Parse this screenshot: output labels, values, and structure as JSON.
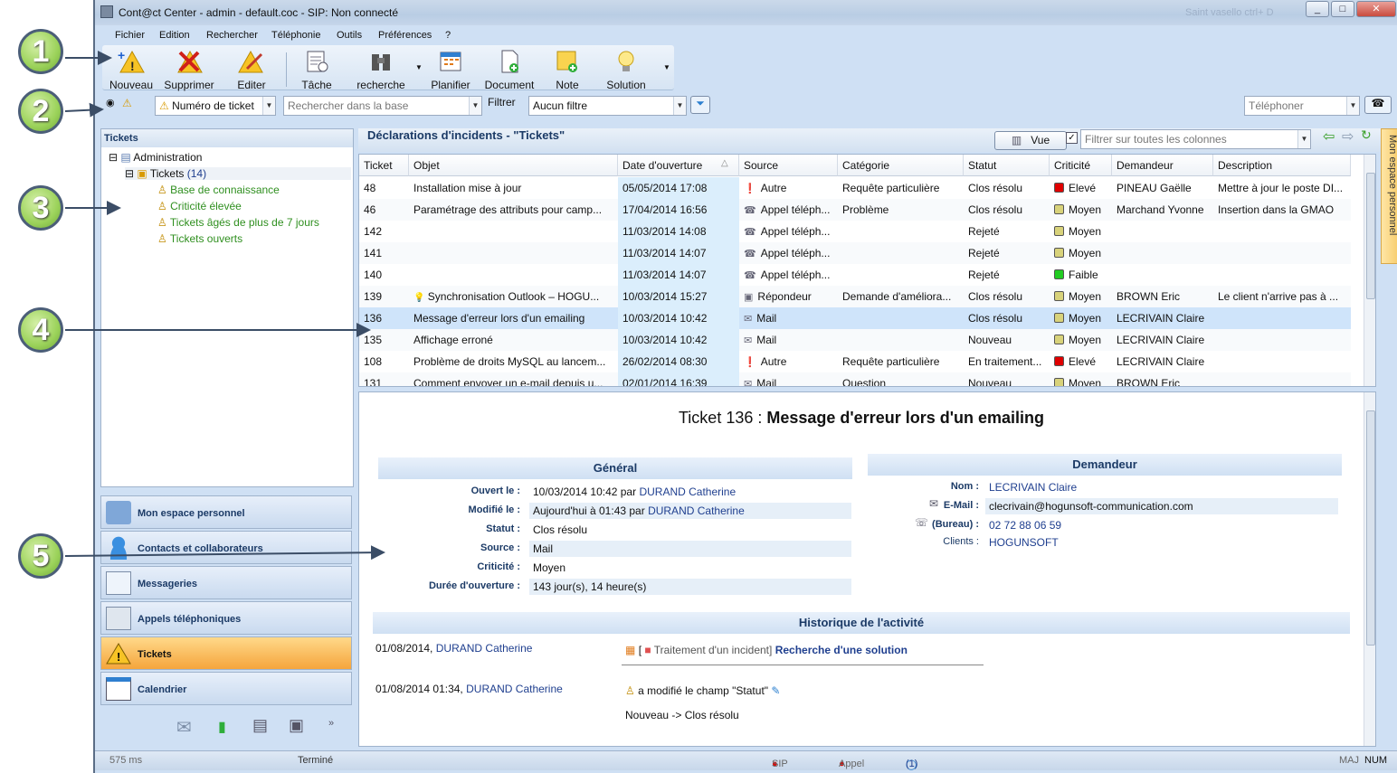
{
  "window": {
    "title": "Cont@ct Center - admin - default.coc - SIP: Non connecté",
    "blurred_title": "Saint vasello ctrl+ D"
  },
  "menu": [
    "Fichier",
    "Edition",
    "Rechercher",
    "Téléphonie",
    "Outils",
    "Préférences",
    "?"
  ],
  "toolbar": {
    "nouveau": "Nouveau",
    "supprimer": "Supprimer",
    "editer": "Editer",
    "tache": "Tâche",
    "recherche": "recherche",
    "planifier": "Planifier",
    "document": "Document",
    "note": "Note",
    "solution": "Solution"
  },
  "searchbar": {
    "field": "Numéro de ticket",
    "search_placeholder": "Rechercher dans la base",
    "filter_label": "Filtrer",
    "filter_value": "Aucun filtre",
    "phone_placeholder": "Téléphoner"
  },
  "tree": {
    "header": "Tickets",
    "root": "Administration",
    "tickets": "Tickets",
    "tickets_count": "(14)",
    "children": [
      "Base de connaissance",
      "Criticité élevée",
      "Tickets âgés de plus de 7 jours",
      "Tickets ouverts"
    ]
  },
  "nav": [
    "Mon espace personnel",
    "Contacts et collaborateurs",
    "Messageries",
    "Appels téléphoniques",
    "Tickets",
    "Calendrier"
  ],
  "grid": {
    "title": "Déclarations d'incidents - \"Tickets\"",
    "vue_button": "Vue",
    "filter_placeholder": "Filtrer sur toutes les colonnes",
    "columns": [
      "Ticket",
      "Objet",
      "Date d'ouverture",
      "Source",
      "Catégorie",
      "Statut",
      "Criticité",
      "Demandeur",
      "Description"
    ],
    "rows": [
      {
        "ticket": "48",
        "objet": "Installation mise à jour",
        "date": "05/05/2014 17:08",
        "source": "Autre",
        "categorie": "Requête particulière",
        "statut": "Clos résolu",
        "crit": "Elevé",
        "critcolor": "#e00000",
        "demandeur": "PINEAU Gaëlle",
        "desc": "Mettre à jour le poste DI..."
      },
      {
        "ticket": "46",
        "objet": "Paramétrage des attributs pour camp...",
        "date": "17/04/2014 16:56",
        "source": "Appel téléph...",
        "categorie": "Problème",
        "statut": "Clos résolu",
        "crit": "Moyen",
        "critcolor": "#d8d27a",
        "demandeur": "Marchand Yvonne",
        "desc": "Insertion dans la GMAO"
      },
      {
        "ticket": "142",
        "objet": "",
        "date": "11/03/2014 14:08",
        "source": "Appel téléph...",
        "categorie": "",
        "statut": "Rejeté",
        "crit": "Moyen",
        "critcolor": "#d8d27a",
        "demandeur": "",
        "desc": ""
      },
      {
        "ticket": "141",
        "objet": "",
        "date": "11/03/2014 14:07",
        "source": "Appel téléph...",
        "categorie": "",
        "statut": "Rejeté",
        "crit": "Moyen",
        "critcolor": "#d8d27a",
        "demandeur": "",
        "desc": ""
      },
      {
        "ticket": "140",
        "objet": "",
        "date": "11/03/2014 14:07",
        "source": "Appel téléph...",
        "categorie": "",
        "statut": "Rejeté",
        "crit": "Faible",
        "critcolor": "#22cc22",
        "demandeur": "",
        "desc": ""
      },
      {
        "ticket": "139",
        "objet": "Synchronisation Outlook – HOGU...",
        "date": "10/03/2014 15:27",
        "source": "Répondeur",
        "categorie": "Demande d'améliora...",
        "statut": "Clos résolu",
        "crit": "Moyen",
        "critcolor": "#d8d27a",
        "demandeur": "BROWN Eric",
        "desc": "Le client n'arrive pas à ..."
      },
      {
        "ticket": "136",
        "objet": "Message d'erreur lors d'un emailing",
        "date": "10/03/2014 10:42",
        "source": "Mail",
        "categorie": "",
        "statut": "Clos résolu",
        "crit": "Moyen",
        "critcolor": "#d8d27a",
        "demandeur": "LECRIVAIN Claire",
        "desc": ""
      },
      {
        "ticket": "135",
        "objet": "Affichage erroné",
        "date": "10/03/2014 10:42",
        "source": "Mail",
        "categorie": "",
        "statut": "Nouveau",
        "crit": "Moyen",
        "critcolor": "#d8d27a",
        "demandeur": "LECRIVAIN Claire",
        "desc": ""
      },
      {
        "ticket": "108",
        "objet": "Problème de droits MySQL au lancem...",
        "date": "26/02/2014 08:30",
        "source": "Autre",
        "categorie": "Requête particulière",
        "statut": "En traitement...",
        "crit": "Elevé",
        "critcolor": "#e00000",
        "demandeur": "LECRIVAIN Claire",
        "desc": ""
      },
      {
        "ticket": "131",
        "objet": "Comment envoyer un e-mail depuis u...",
        "date": "02/01/2014 16:39",
        "source": "Mail",
        "categorie": "Question",
        "statut": "Nouveau",
        "crit": "Moyen",
        "critcolor": "#d8d27a",
        "demandeur": "BROWN Eric",
        "desc": ""
      }
    ]
  },
  "detail": {
    "ticket_prefix": "Ticket 136 : ",
    "ticket_title": "Message d'erreur lors d'un emailing",
    "general": "Général",
    "demandeur": "Demandeur",
    "ouvert_label": "Ouvert le :",
    "ouvert_val": "10/03/2014 10:42 par",
    "ouvert_by": "DURAND Catherine",
    "modifie_label": "Modifié le :",
    "modifie_val": "Aujourd'hui à 01:43 par",
    "modifie_by": "DURAND Catherine",
    "statut_label": "Statut :",
    "statut_val": "Clos résolu",
    "source_label": "Source :",
    "source_val": "Mail",
    "crit_label": "Criticité :",
    "crit_val": "Moyen",
    "duree_label": "Durée d'ouverture :",
    "duree_val": "143 jour(s), 14 heure(s)",
    "nom_label": "Nom :",
    "nom_val": "LECRIVAIN Claire",
    "email_label": "E-Mail :",
    "email_val": "clecrivain@hogunsoft-communication.com",
    "bureau_label": "(Bureau) :",
    "bureau_val": "02 72 88 06 59",
    "clients_label": "Clients :",
    "clients_val": "HOGUNSOFT",
    "historique": "Historique de l'activité",
    "h1_date": "01/08/2014,",
    "h1_user": "DURAND Catherine",
    "h1_pre": "[",
    "h1_bracket": "Traitement d'un incident]",
    "h1_title": "Recherche d'une solution",
    "h2_date": "01/08/2014 01:34,",
    "h2_user": "DURAND Catherine",
    "h2_action": "a modifié le champ \"Statut\"",
    "h2_change": "Nouveau -> Clos résolu"
  },
  "statusbar": {
    "time": "575 ms",
    "state": "Terminé",
    "sip": "SIP",
    "appel": "Appel",
    "msgs": "(1)",
    "maj": "MAJ",
    "num": "NUM"
  },
  "rightstrip": "Mon espace personnel",
  "callouts": [
    "1",
    "2",
    "3",
    "4",
    "5"
  ]
}
